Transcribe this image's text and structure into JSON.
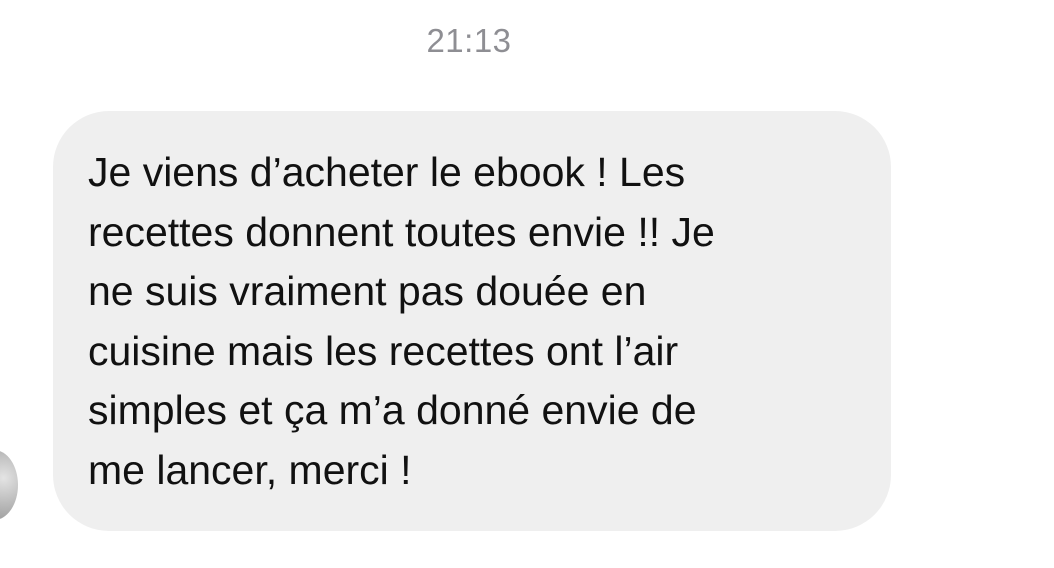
{
  "chat": {
    "timestamp": "21:13",
    "message": {
      "lines": [
        "Je viens d’acheter le ebook ! Les",
        "recettes donnent toutes envie !! Je",
        "ne suis vraiment pas douée en",
        "cuisine mais les recettes ont l’air",
        "simples et ça m’a donné envie de",
        "me lancer, merci !"
      ],
      "bubble_color": "#efefef",
      "text_color": "#111111"
    },
    "timestamp_color": "#8e8e93"
  }
}
